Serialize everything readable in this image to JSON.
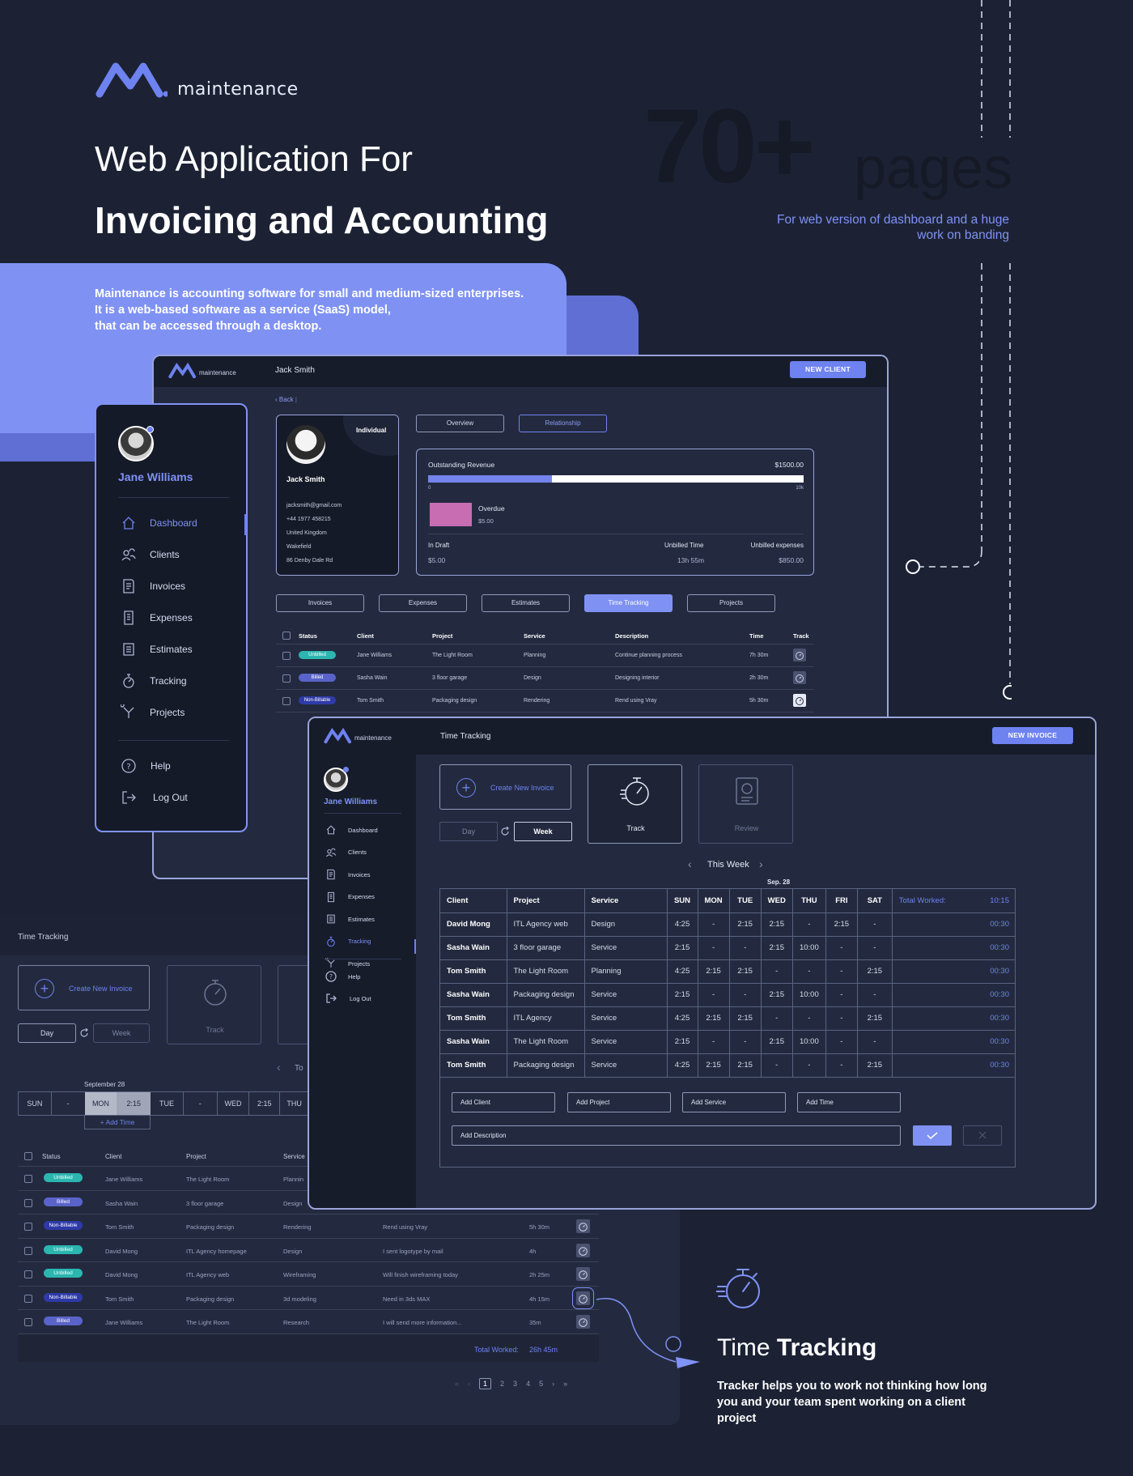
{
  "brand": {
    "name": "maintenance"
  },
  "hero": {
    "subtitle": "Web Application For",
    "title": "Invoicing and Accounting",
    "pages_number": "70+",
    "pages_word": "pages",
    "pages_caption_1": "For web version of dashboard and a huge",
    "pages_caption_2": "work on banding",
    "desc_1": "Maintenance is accounting software for small and medium-sized enterprises.",
    "desc_2": "It is a web-based software as a service (SaaS) model,",
    "desc_3": "that can be accessed through a desktop."
  },
  "sidebar": {
    "user": "Jane Williams",
    "items": [
      {
        "label": "Dashboard",
        "icon": "home-icon"
      },
      {
        "label": "Clients",
        "icon": "clients-icon"
      },
      {
        "label": "Invoices",
        "icon": "invoice-icon"
      },
      {
        "label": "Expenses",
        "icon": "expenses-icon"
      },
      {
        "label": "Estimates",
        "icon": "estimates-icon"
      },
      {
        "label": "Tracking",
        "icon": "stopwatch-icon"
      },
      {
        "label": "Projects",
        "icon": "projects-icon"
      }
    ],
    "help": "Help",
    "logout": "Log Out"
  },
  "client_screen": {
    "header_title": "Jack Smith",
    "new_client": "NEW CLIENT",
    "back": "Back",
    "card": {
      "type": "Individual",
      "name": "Jack Smith",
      "email": "jacksmith@gmail.com",
      "phone": "+44 1977 458215",
      "country": "United Kingdom",
      "city": "Wakefield",
      "street": "86 Denby Dale Rd"
    },
    "tabs_top": [
      "Overview",
      "Relationship"
    ],
    "revenue": {
      "label": "Outstanding Revenue",
      "amount": "$1500.00",
      "progress": 0.33,
      "min": "0",
      "max": "10k",
      "overdue_label": "Overdue",
      "overdue_amount": "$5.00",
      "in_draft_label": "In Draft",
      "in_draft_amount": "$5.00",
      "unbilled_time_label": "Unbilled Time",
      "unbilled_time": "13h 55m",
      "unbilled_exp_label": "Unbilled expenses",
      "unbilled_exp": "$850.00"
    },
    "tabs": [
      "Invoices",
      "Expenses",
      "Estimates",
      "Time Tracking",
      "Projects"
    ],
    "table_headers": [
      "Status",
      "Client",
      "Project",
      "Service",
      "Description",
      "Time",
      "Track"
    ],
    "rows": [
      {
        "status": "Unbilled",
        "client": "Jane Williams",
        "project": "The Light Room",
        "service": "Planning",
        "desc": "Continue planning process",
        "time": "7h 30m"
      },
      {
        "status": "Billed",
        "client": "Sasha Wain",
        "project": "3 floor garage",
        "service": "Design",
        "desc": "Designing interior",
        "time": "2h 30m"
      },
      {
        "status": "Non-Billable",
        "client": "Tom Smith",
        "project": "Packaging design",
        "service": "Rendering",
        "desc": "Rend using Vray",
        "time": "5h 30m"
      }
    ]
  },
  "tracking_back": {
    "title": "Time Tracking",
    "create": "Create New Invoice",
    "track": "Track",
    "day": "Day",
    "week": "Week",
    "date": "September 28",
    "today": "To",
    "days": [
      {
        "d": "SUN",
        "v": "-"
      },
      {
        "d": "MON",
        "v": "2:15"
      },
      {
        "d": "TUE",
        "v": "-"
      },
      {
        "d": "WED",
        "v": "2:15"
      },
      {
        "d": "THU",
        "v": ""
      }
    ],
    "add_time": "Add Time",
    "headers": [
      "Status",
      "Client",
      "Project",
      "Service"
    ],
    "rows": [
      {
        "status": "Unbilled",
        "client": "Jane Williams",
        "project": "The Light Room",
        "service": "Plannin",
        "desc": "",
        "time": ""
      },
      {
        "status": "Billed",
        "client": "Sasha Wain",
        "project": "3 floor garage",
        "service": "Design",
        "desc": "",
        "time": ""
      },
      {
        "status": "Non-Billable",
        "client": "Tom Smith",
        "project": "Packaging design",
        "service": "Rendering",
        "desc": "Rend using Vray",
        "time": "5h 30m"
      },
      {
        "status": "Unbilled",
        "client": "David Mong",
        "project": "ITL Agency homepage",
        "service": "Design",
        "desc": "I sent logotype by mail",
        "time": "4h"
      },
      {
        "status": "Unbilled",
        "client": "David Mong",
        "project": "ITL Agency web",
        "service": "Wireframing",
        "desc": "Will finish wireframing today",
        "time": "2h 25m"
      },
      {
        "status": "Non-Billable",
        "client": "Tom Smith",
        "project": "Packaging design",
        "service": "3d modeling",
        "desc": "Need in 3ds MAX",
        "time": "4h 15m"
      },
      {
        "status": "Billed",
        "client": "Jane Williams",
        "project": "The Light Room",
        "service": "Research",
        "desc": "I will send more information...",
        "time": "35m"
      }
    ],
    "total_label": "Total Worked:",
    "total": "26h 45m",
    "pages": [
      "1",
      "2",
      "3",
      "4",
      "5"
    ]
  },
  "tracking_front": {
    "header_title": "Time Tracking",
    "new_invoice": "NEW INVOICE",
    "create": "Create New Invoice",
    "track": "Track",
    "review": "Review",
    "day": "Day",
    "week": "Week",
    "this_week": "This Week",
    "date": "Sep. 28",
    "headers": [
      "Client",
      "Project",
      "Service",
      "SUN",
      "MON",
      "TUE",
      "WED",
      "THU",
      "FRI",
      "SAT"
    ],
    "total_label": "Total Worked:",
    "total": "10:15",
    "rows": [
      {
        "client": "David Mong",
        "project": "ITL Agency web",
        "service": "Design",
        "d": [
          "4:25",
          "-",
          "2:15",
          "2:15",
          "-",
          "2:15",
          "-"
        ],
        "total": "00:30"
      },
      {
        "client": "Sasha Wain",
        "project": "3 floor garage",
        "service": "Service",
        "d": [
          "2:15",
          "-",
          "-",
          "2:15",
          "10:00",
          "-",
          "-"
        ],
        "total": "00:30"
      },
      {
        "client": "Tom Smith",
        "project": "The Light Room",
        "service": "Planning",
        "d": [
          "4:25",
          "2:15",
          "2:15",
          "-",
          "-",
          "-",
          "2:15"
        ],
        "total": "00:30"
      },
      {
        "client": "Sasha Wain",
        "project": "Packaging design",
        "service": "Service",
        "d": [
          "2:15",
          "-",
          "-",
          "2:15",
          "10:00",
          "-",
          "-"
        ],
        "total": "00:30"
      },
      {
        "client": "Tom Smith",
        "project": "ITL Agency",
        "service": "Service",
        "d": [
          "4:25",
          "2:15",
          "2:15",
          "-",
          "-",
          "-",
          "2:15"
        ],
        "total": "00:30"
      },
      {
        "client": "Sasha Wain",
        "project": "The Light Room",
        "service": "Service",
        "d": [
          "2:15",
          "-",
          "-",
          "2:15",
          "10:00",
          "-",
          "-"
        ],
        "total": "00:30"
      },
      {
        "client": "Tom Smith",
        "project": "Packaging design",
        "service": "Service",
        "d": [
          "4:25",
          "2:15",
          "2:15",
          "-",
          "-",
          "-",
          "2:15"
        ],
        "total": "00:30"
      }
    ],
    "add_client": "Add Client",
    "add_project": "Add Project",
    "add_service": "Add Service",
    "add_time": "Add Time",
    "add_desc": "Add Description"
  },
  "feature": {
    "title_light": "Time",
    "title_bold": "Tracking",
    "desc_1": "Tracker helps you to work not thinking how long",
    "desc_2": "you and your team spent working on a client",
    "desc_3": "project"
  },
  "colors": {
    "bg": "#1c2234",
    "accent": "#6e82f0",
    "panel": "#232a3f",
    "dark": "#171c2b"
  }
}
